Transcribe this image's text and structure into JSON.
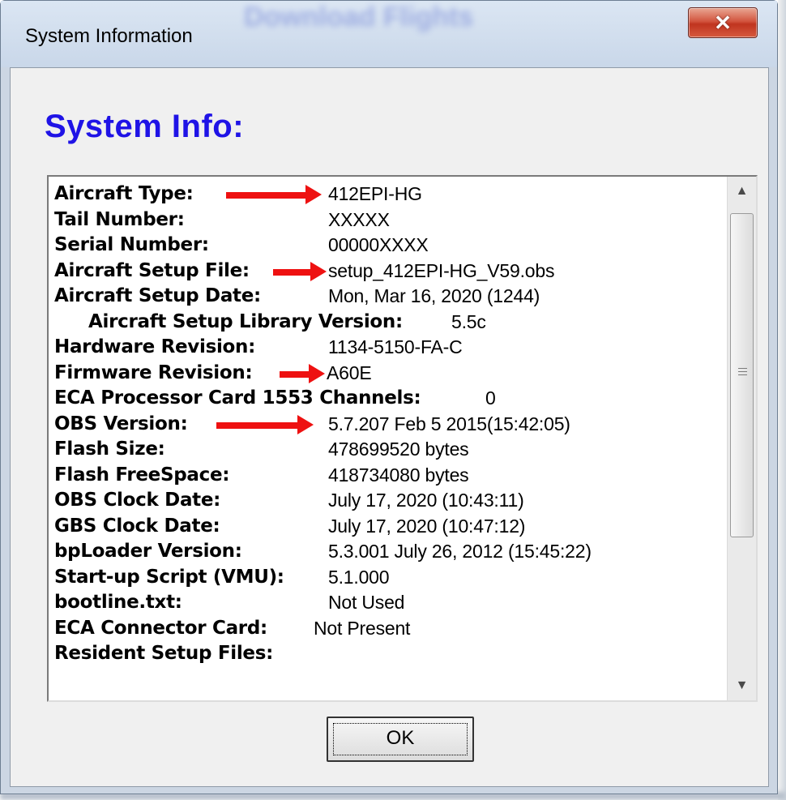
{
  "window": {
    "title": "System Information",
    "background_title": "Download Flights"
  },
  "dialog": {
    "heading": "System Info:",
    "ok_label": "OK",
    "heading_color": "#1f13e6",
    "arrow_color": "#ee1111"
  },
  "info": {
    "rows": [
      {
        "label": "Aircraft Type:",
        "value": "412EPI-HG",
        "has_arrow": true
      },
      {
        "label": "Tail Number:",
        "value": "XXXXX"
      },
      {
        "label": "Serial Number:",
        "value": "00000XXXX"
      },
      {
        "label": "Aircraft Setup File:",
        "value": "setup_412EPI-HG_V59.obs",
        "has_arrow": true
      },
      {
        "label": "Aircraft Setup Date:",
        "value": "Mon, Mar 16, 2020 (1244)"
      },
      {
        "label": "Aircraft Setup Library Version:",
        "value": "5.5c"
      },
      {
        "label": "Hardware Revision:",
        "value": "1134-5150-FA-C"
      },
      {
        "label": "Firmware Revision:",
        "value": "A60E",
        "has_arrow": true
      },
      {
        "label": "ECA Processor Card 1553 Channels:",
        "value": "0"
      },
      {
        "label": "OBS Version:",
        "value": "5.7.207  Feb  5 2015(15:42:05)",
        "has_arrow": true
      },
      {
        "label": "Flash Size:",
        "value": "478699520 bytes"
      },
      {
        "label": "Flash FreeSpace:",
        "value": "418734080 bytes"
      },
      {
        "label": "OBS Clock Date:",
        "value": "July 17, 2020 (10:43:11)"
      },
      {
        "label": "GBS Clock Date:",
        "value": "July 17, 2020 (10:47:12)"
      },
      {
        "label": "bpLoader Version:",
        "value": "5.3.001 July 26, 2012 (15:45:22)"
      },
      {
        "label": "Start-up Script (VMU):",
        "value": "5.1.000"
      },
      {
        "label": "bootline.txt:",
        "value": "Not Used"
      },
      {
        "label": "ECA Connector Card:",
        "value": "Not Present"
      },
      {
        "label": "Resident Setup Files:",
        "value": ""
      }
    ]
  },
  "scrollbar": {
    "up_icon": "up-arrow-icon",
    "down_icon": "down-arrow-icon",
    "grip_icon": "grip-icon"
  }
}
